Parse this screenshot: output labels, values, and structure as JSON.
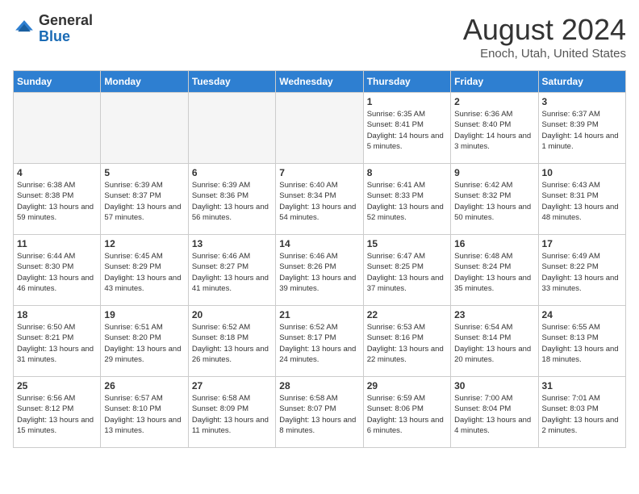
{
  "header": {
    "logo_general": "General",
    "logo_blue": "Blue",
    "title": "August 2024",
    "location": "Enoch, Utah, United States"
  },
  "days_of_week": [
    "Sunday",
    "Monday",
    "Tuesday",
    "Wednesday",
    "Thursday",
    "Friday",
    "Saturday"
  ],
  "weeks": [
    [
      {
        "day": "",
        "empty": true
      },
      {
        "day": "",
        "empty": true
      },
      {
        "day": "",
        "empty": true
      },
      {
        "day": "",
        "empty": true
      },
      {
        "day": "1",
        "sunrise": "6:35 AM",
        "sunset": "8:41 PM",
        "daylight": "14 hours and 5 minutes."
      },
      {
        "day": "2",
        "sunrise": "6:36 AM",
        "sunset": "8:40 PM",
        "daylight": "14 hours and 3 minutes."
      },
      {
        "day": "3",
        "sunrise": "6:37 AM",
        "sunset": "8:39 PM",
        "daylight": "14 hours and 1 minute."
      }
    ],
    [
      {
        "day": "4",
        "sunrise": "6:38 AM",
        "sunset": "8:38 PM",
        "daylight": "13 hours and 59 minutes."
      },
      {
        "day": "5",
        "sunrise": "6:39 AM",
        "sunset": "8:37 PM",
        "daylight": "13 hours and 57 minutes."
      },
      {
        "day": "6",
        "sunrise": "6:39 AM",
        "sunset": "8:36 PM",
        "daylight": "13 hours and 56 minutes."
      },
      {
        "day": "7",
        "sunrise": "6:40 AM",
        "sunset": "8:34 PM",
        "daylight": "13 hours and 54 minutes."
      },
      {
        "day": "8",
        "sunrise": "6:41 AM",
        "sunset": "8:33 PM",
        "daylight": "13 hours and 52 minutes."
      },
      {
        "day": "9",
        "sunrise": "6:42 AM",
        "sunset": "8:32 PM",
        "daylight": "13 hours and 50 minutes."
      },
      {
        "day": "10",
        "sunrise": "6:43 AM",
        "sunset": "8:31 PM",
        "daylight": "13 hours and 48 minutes."
      }
    ],
    [
      {
        "day": "11",
        "sunrise": "6:44 AM",
        "sunset": "8:30 PM",
        "daylight": "13 hours and 46 minutes."
      },
      {
        "day": "12",
        "sunrise": "6:45 AM",
        "sunset": "8:29 PM",
        "daylight": "13 hours and 43 minutes."
      },
      {
        "day": "13",
        "sunrise": "6:46 AM",
        "sunset": "8:27 PM",
        "daylight": "13 hours and 41 minutes."
      },
      {
        "day": "14",
        "sunrise": "6:46 AM",
        "sunset": "8:26 PM",
        "daylight": "13 hours and 39 minutes."
      },
      {
        "day": "15",
        "sunrise": "6:47 AM",
        "sunset": "8:25 PM",
        "daylight": "13 hours and 37 minutes."
      },
      {
        "day": "16",
        "sunrise": "6:48 AM",
        "sunset": "8:24 PM",
        "daylight": "13 hours and 35 minutes."
      },
      {
        "day": "17",
        "sunrise": "6:49 AM",
        "sunset": "8:22 PM",
        "daylight": "13 hours and 33 minutes."
      }
    ],
    [
      {
        "day": "18",
        "sunrise": "6:50 AM",
        "sunset": "8:21 PM",
        "daylight": "13 hours and 31 minutes."
      },
      {
        "day": "19",
        "sunrise": "6:51 AM",
        "sunset": "8:20 PM",
        "daylight": "13 hours and 29 minutes."
      },
      {
        "day": "20",
        "sunrise": "6:52 AM",
        "sunset": "8:18 PM",
        "daylight": "13 hours and 26 minutes."
      },
      {
        "day": "21",
        "sunrise": "6:52 AM",
        "sunset": "8:17 PM",
        "daylight": "13 hours and 24 minutes."
      },
      {
        "day": "22",
        "sunrise": "6:53 AM",
        "sunset": "8:16 PM",
        "daylight": "13 hours and 22 minutes."
      },
      {
        "day": "23",
        "sunrise": "6:54 AM",
        "sunset": "8:14 PM",
        "daylight": "13 hours and 20 minutes."
      },
      {
        "day": "24",
        "sunrise": "6:55 AM",
        "sunset": "8:13 PM",
        "daylight": "13 hours and 18 minutes."
      }
    ],
    [
      {
        "day": "25",
        "sunrise": "6:56 AM",
        "sunset": "8:12 PM",
        "daylight": "13 hours and 15 minutes."
      },
      {
        "day": "26",
        "sunrise": "6:57 AM",
        "sunset": "8:10 PM",
        "daylight": "13 hours and 13 minutes."
      },
      {
        "day": "27",
        "sunrise": "6:58 AM",
        "sunset": "8:09 PM",
        "daylight": "13 hours and 11 minutes."
      },
      {
        "day": "28",
        "sunrise": "6:58 AM",
        "sunset": "8:07 PM",
        "daylight": "13 hours and 8 minutes."
      },
      {
        "day": "29",
        "sunrise": "6:59 AM",
        "sunset": "8:06 PM",
        "daylight": "13 hours and 6 minutes."
      },
      {
        "day": "30",
        "sunrise": "7:00 AM",
        "sunset": "8:04 PM",
        "daylight": "13 hours and 4 minutes."
      },
      {
        "day": "31",
        "sunrise": "7:01 AM",
        "sunset": "8:03 PM",
        "daylight": "13 hours and 2 minutes."
      }
    ]
  ]
}
